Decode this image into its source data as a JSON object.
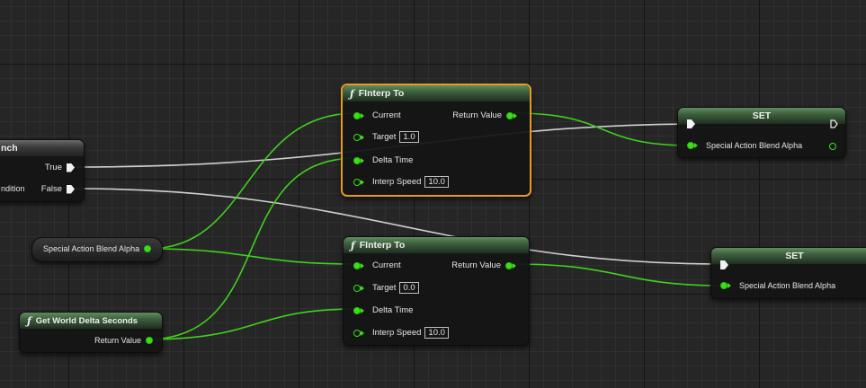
{
  "nodes": {
    "branch": {
      "true_label": "True",
      "false_label": "False",
      "title_fragment": "nch",
      "condition_fragment": "ndition"
    },
    "var_get": {
      "label": "Special Action Blend Alpha"
    },
    "delta": {
      "title": "Get World Delta Seconds",
      "return_label": "Return Value"
    },
    "finterp_top": {
      "title": "FInterp To",
      "current": "Current",
      "target": "Target",
      "target_value": "1.0",
      "delta_time": "Delta Time",
      "interp_speed": "Interp Speed",
      "interp_speed_value": "10.0",
      "return_label": "Return Value"
    },
    "finterp_bottom": {
      "title": "FInterp To",
      "current": "Current",
      "target": "Target",
      "target_value": "0.0",
      "delta_time": "Delta Time",
      "interp_speed": "Interp Speed",
      "interp_speed_value": "10.0",
      "return_label": "Return Value"
    },
    "set_top": {
      "title": "SET",
      "var_label": "Special Action Blend Alpha"
    },
    "set_bottom": {
      "title": "SET",
      "var_label": "Special Action Blend Alpha"
    }
  },
  "colors": {
    "float_pin": "#39e01a",
    "exec_wire": "#cfcfcf",
    "selection": "#e69a26",
    "header_green": "#4f7a4f"
  },
  "icons": {
    "function": "function-f-icon",
    "exec": "exec-pin-icon",
    "data": "float-pin-icon"
  }
}
